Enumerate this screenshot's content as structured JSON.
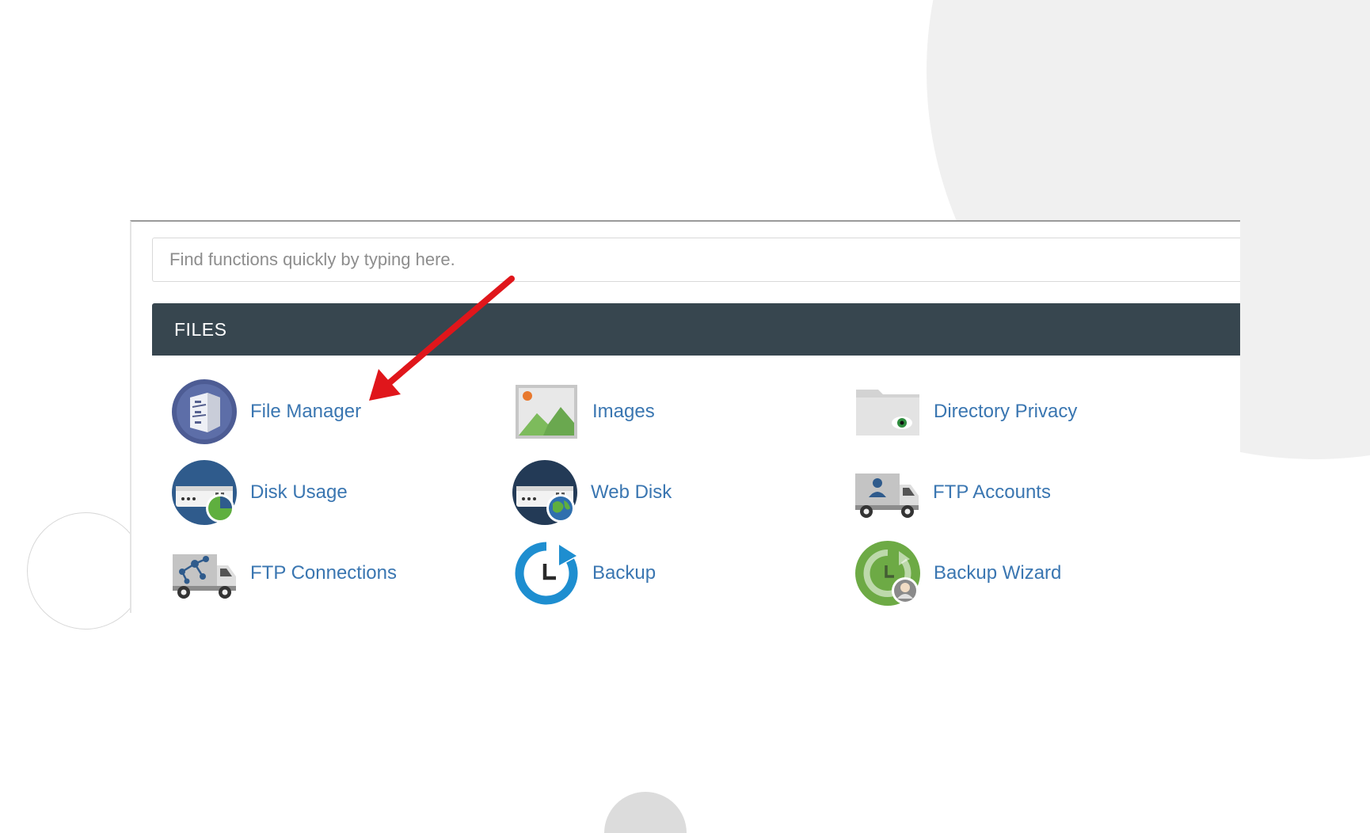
{
  "search": {
    "placeholder": "Find functions quickly by typing here."
  },
  "section": {
    "title": "FILES"
  },
  "tools": [
    {
      "label": "File Manager",
      "icon": "file-cabinet-icon"
    },
    {
      "label": "Images",
      "icon": "image-icon"
    },
    {
      "label": "Directory Privacy",
      "icon": "folder-eye-icon"
    },
    {
      "label": "Disk Usage",
      "icon": "disk-usage-icon"
    },
    {
      "label": "Web Disk",
      "icon": "web-disk-icon"
    },
    {
      "label": "FTP Accounts",
      "icon": "ftp-accounts-truck-icon"
    },
    {
      "label": "FTP Connections",
      "icon": "ftp-connections-truck-icon"
    },
    {
      "label": "Backup",
      "icon": "backup-icon"
    },
    {
      "label": "Backup Wizard",
      "icon": "backup-wizard-icon"
    }
  ],
  "colors": {
    "header_bg": "#37464f",
    "link": "#3a76b1",
    "arrow": "#e0161b"
  }
}
